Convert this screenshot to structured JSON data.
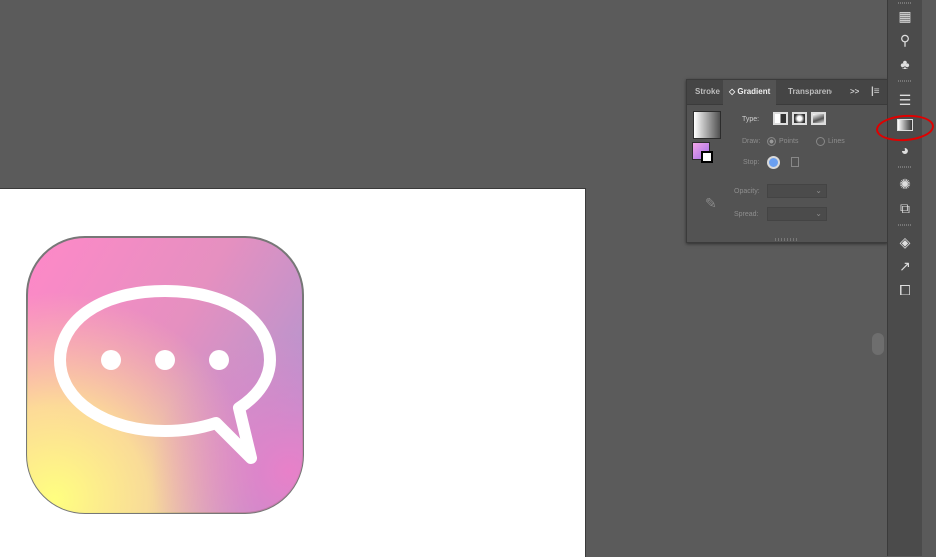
{
  "panel": {
    "tabs": {
      "stroke": "Stroke",
      "gradient": "◇ Gradient",
      "transparency": "Transparenc",
      "more": ">>",
      "menu": "|≡"
    },
    "type_label": "Type:",
    "draw_label": "Draw:",
    "points_label": "Points",
    "lines_label": "Lines",
    "stop_label": "Stop:",
    "opacity_label": "Opacity:",
    "spread_label": "Spread:"
  },
  "toolbar": {
    "icons": [
      "swatches-icon",
      "symbols-icon",
      "graphic-styles-icon",
      "stroke-icon",
      "gradient-icon",
      "transparency-icon",
      "brightness-icon",
      "align-icon",
      "layers-icon",
      "export-icon",
      "pathfinder-icon"
    ]
  },
  "colors": {
    "annotation": "#e00000",
    "artboard": "#ffffff",
    "icon_gradient_pink": "#f38fc0",
    "icon_gradient_yellow": "#ffff88",
    "icon_gradient_purple": "#b08fd0"
  }
}
